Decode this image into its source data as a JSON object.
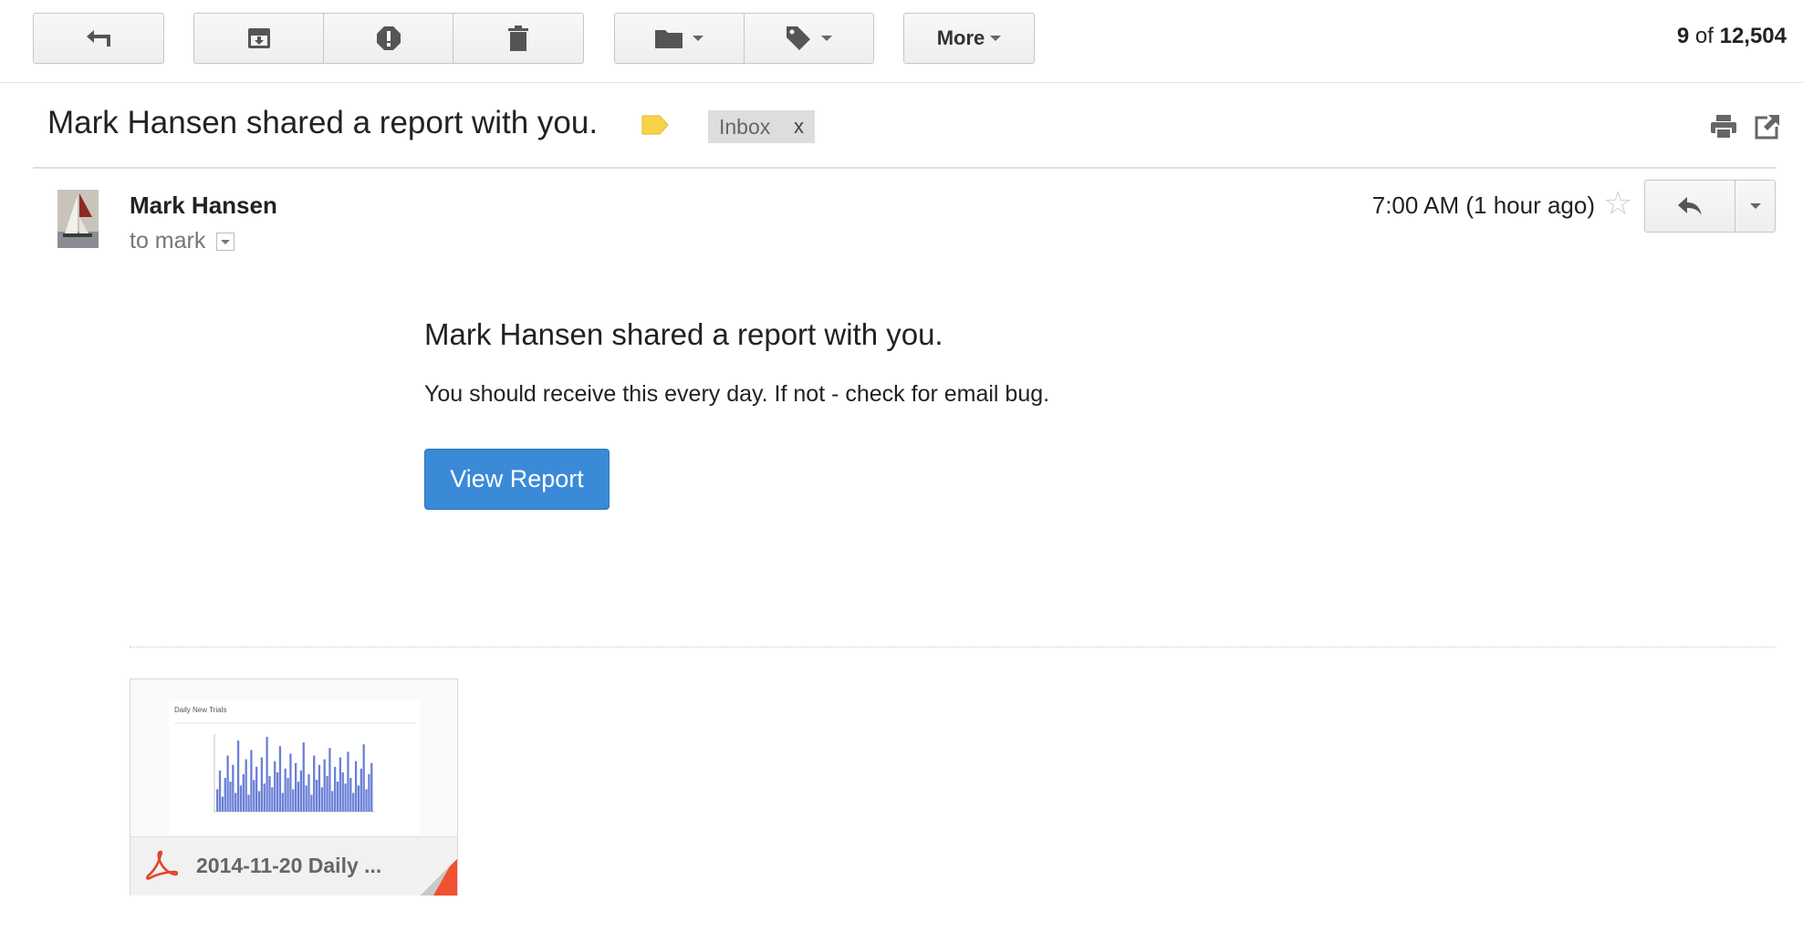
{
  "toolbar": {
    "buttons": [
      {
        "name": "back-button",
        "icon": "back-arrow-icon"
      },
      {
        "name": "archive-button",
        "icon": "archive-icon"
      },
      {
        "name": "report-spam-button",
        "icon": "spam-icon"
      },
      {
        "name": "delete-button",
        "icon": "trash-icon"
      },
      {
        "name": "move-to-button",
        "icon": "folder-icon"
      },
      {
        "name": "labels-button",
        "icon": "tag-icon"
      }
    ],
    "more_label": "More"
  },
  "pagination": {
    "current": "9",
    "of": "of",
    "total": "12,504"
  },
  "subject": "Mark Hansen shared a report with you.",
  "inbox_chip": {
    "label": "Inbox",
    "remove": "x"
  },
  "colors": {
    "label_tag": "#f8d34a",
    "view_button": "#3a8ad8",
    "pdf_red": "#e0462a"
  },
  "message": {
    "sender": "Mark Hansen",
    "to": "to mark",
    "time": "7:00 AM (1 hour ago)",
    "body_title": "Mark Hansen shared a report with you.",
    "body_text": "You should receive this every day. If not - check for email bug.",
    "button": "View Report"
  },
  "attachment": {
    "filename": "2014-11-20 Daily ...",
    "thumbnail_title": "Daily New Trials",
    "thumbnail_chart": {
      "type": "bar",
      "values": [
        12,
        22,
        8,
        18,
        30,
        16,
        25,
        10,
        38,
        14,
        20,
        28,
        9,
        33,
        17,
        24,
        11,
        29,
        15,
        40,
        19,
        13,
        27,
        21,
        35,
        10,
        23,
        18,
        31,
        12,
        26,
        16,
        22,
        37,
        14,
        20,
        9,
        30,
        17,
        25,
        13,
        28,
        19,
        34,
        11,
        24,
        16,
        29,
        21,
        15,
        32,
        18,
        10,
        27,
        14,
        23,
        36,
        12,
        20,
        26
      ]
    }
  }
}
